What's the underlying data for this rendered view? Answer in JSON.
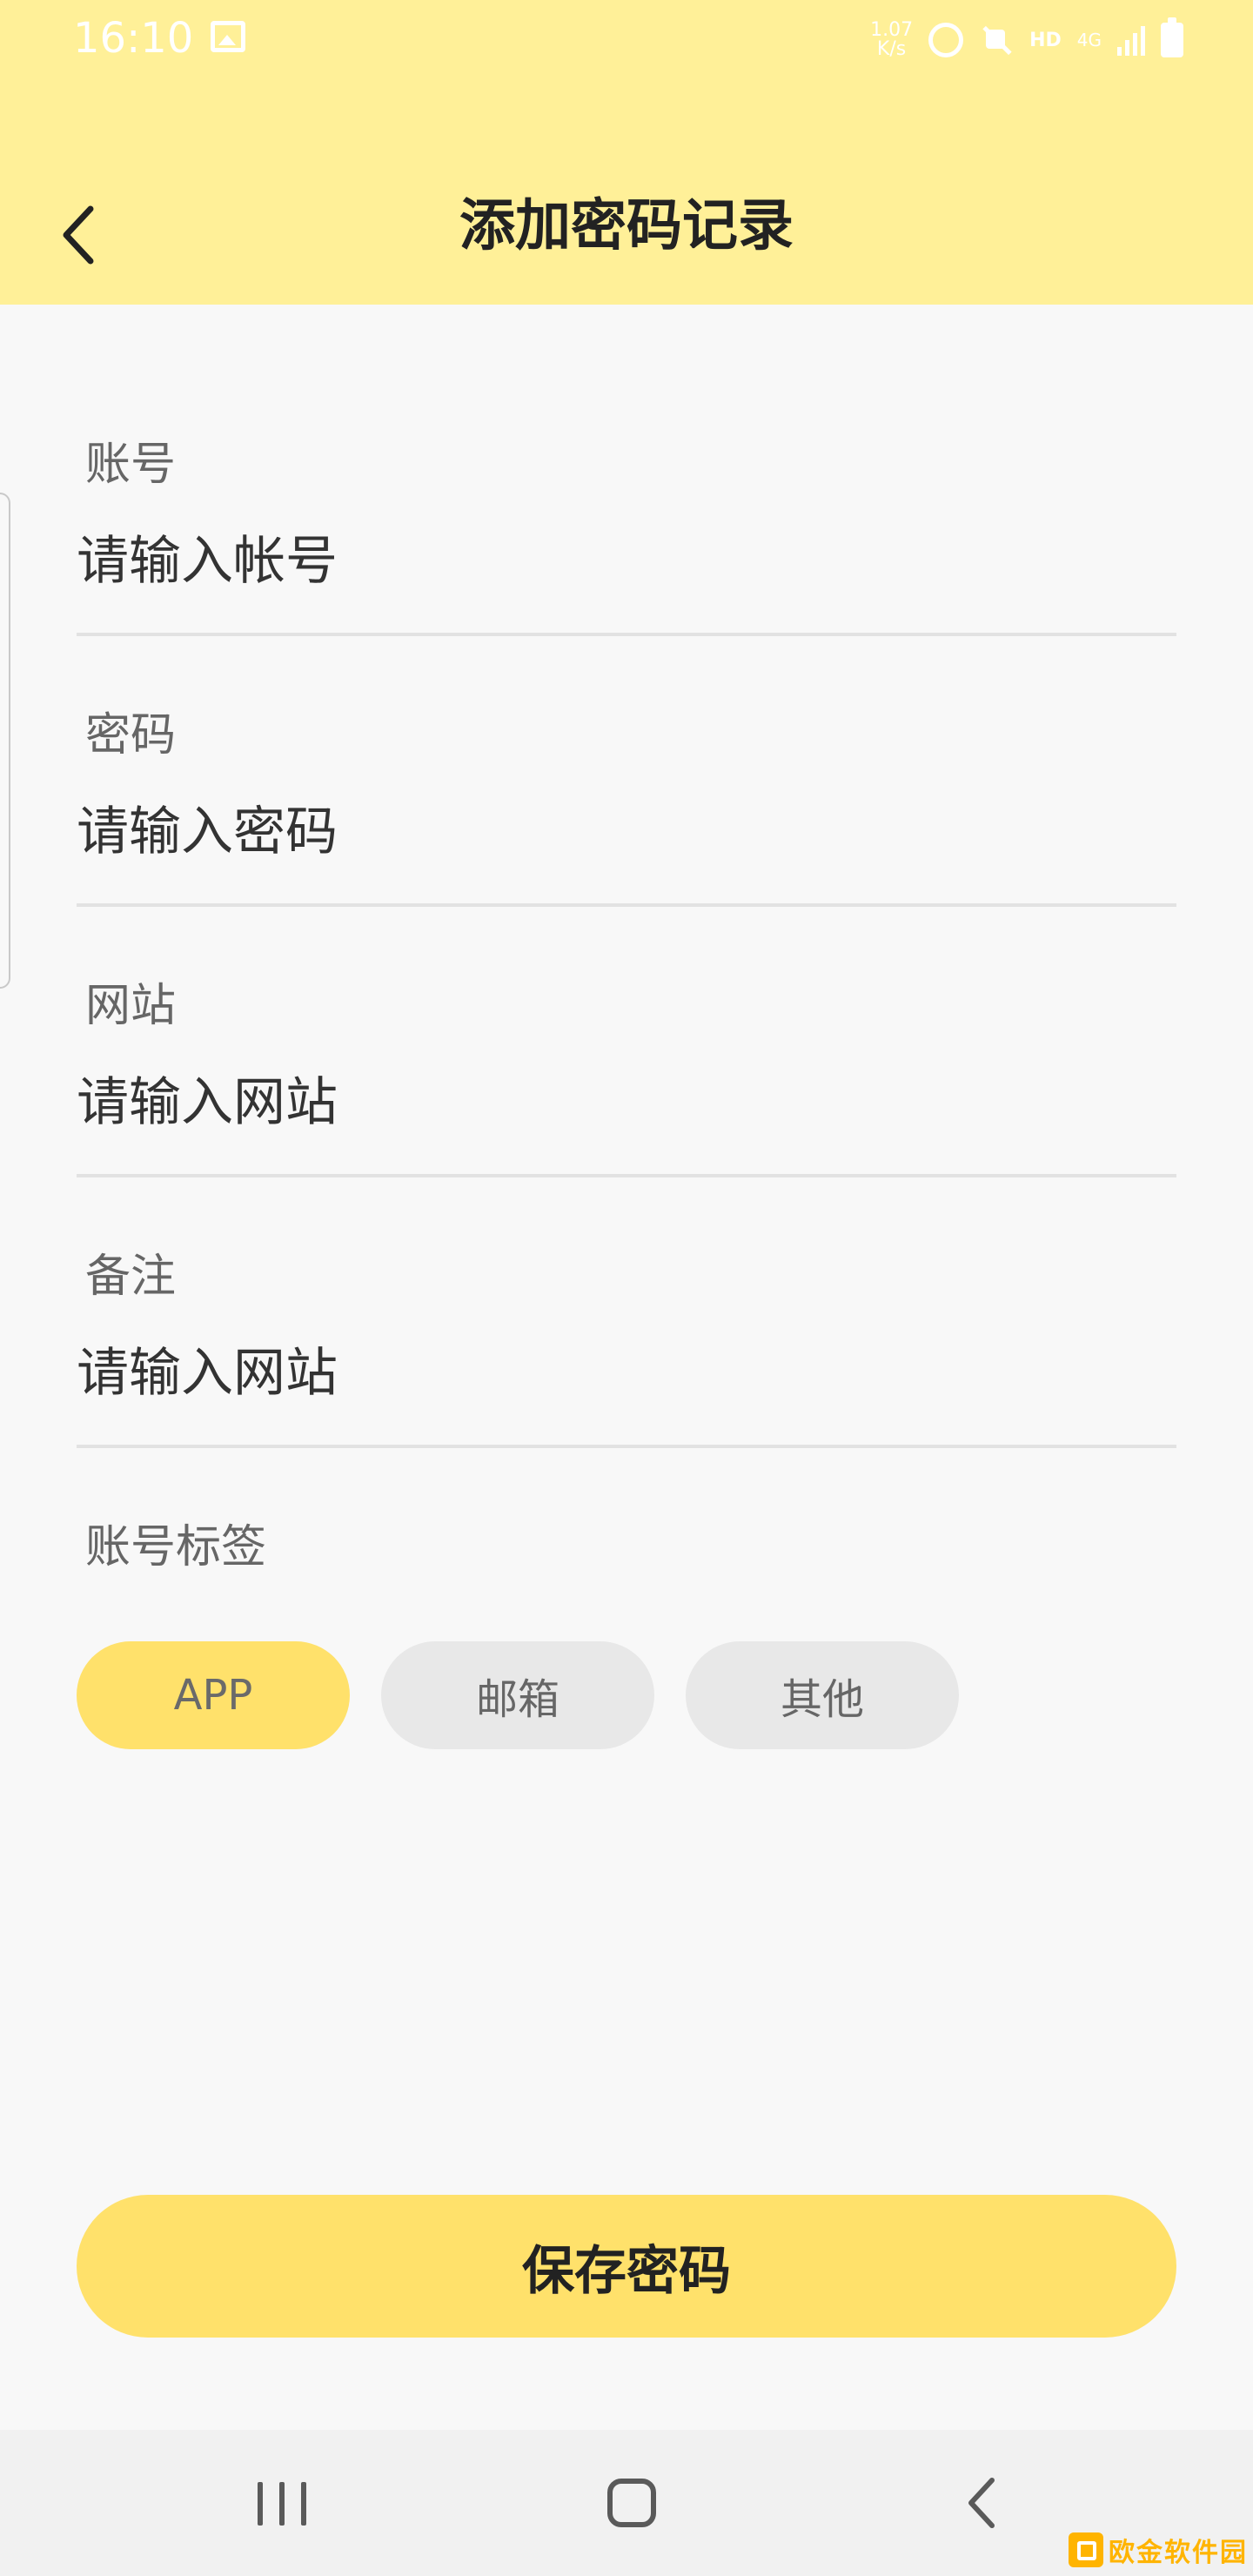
{
  "status_bar": {
    "time": "16:10",
    "net_speed": "1.07\nK/s",
    "hd": "HD",
    "network": "4G"
  },
  "app_bar": {
    "title": "添加密码记录"
  },
  "form": {
    "fields": [
      {
        "label": "账号",
        "placeholder": "请输入帐号"
      },
      {
        "label": "密码",
        "placeholder": "请输入密码"
      },
      {
        "label": "网站",
        "placeholder": "请输入网站"
      },
      {
        "label": "备注",
        "placeholder": "请输入网站"
      }
    ],
    "tags_label": "账号标签",
    "tags": [
      {
        "label": "APP",
        "selected": true
      },
      {
        "label": "邮箱",
        "selected": false
      },
      {
        "label": "其他",
        "selected": false
      }
    ]
  },
  "save_button": {
    "label": "保存密码"
  },
  "watermark": {
    "text": "欧金软件园"
  },
  "colors": {
    "header_bg": "#fff098",
    "accent": "#ffe16b",
    "tag_inactive": "#e8e8e8",
    "page_bg": "#f8f8f8"
  },
  "icons": {
    "back": "chevron-left-icon",
    "nav_recents": "recents-icon",
    "nav_home": "home-icon",
    "nav_back": "back-icon"
  }
}
